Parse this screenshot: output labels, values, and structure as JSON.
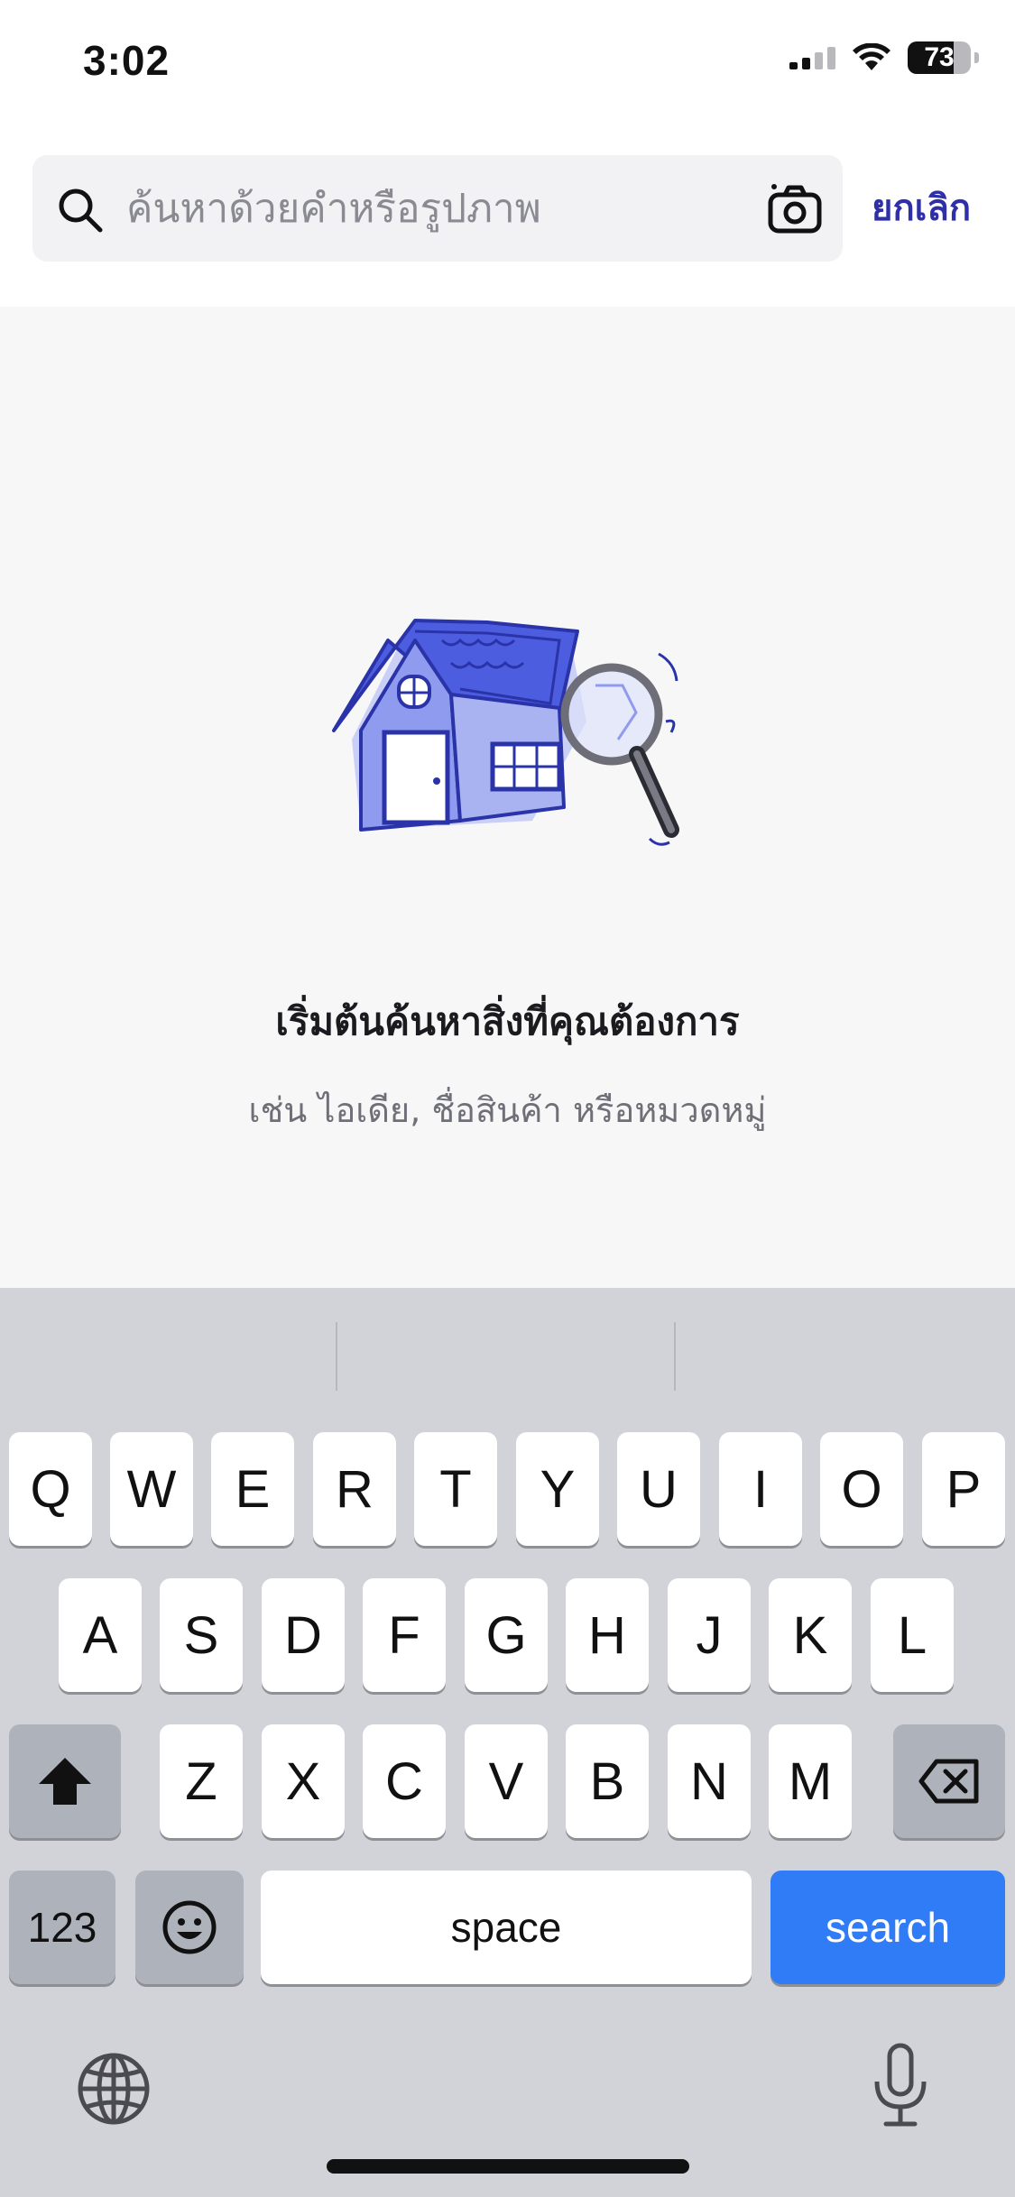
{
  "status_bar": {
    "time": "3:02",
    "battery": "73",
    "battery_level": 0.73
  },
  "search": {
    "placeholder": "ค้นหาด้วยคำหรือรูปภาพ",
    "value": "",
    "cancel_label": "ยกเลิก"
  },
  "empty_state": {
    "title": "เริ่มต้นค้นหาสิ่งที่คุณต้องการ",
    "subtitle": "เช่น ไอเดีย, ชื่อสินค้า หรือหมวดหมู่"
  },
  "keyboard": {
    "row1": [
      "Q",
      "W",
      "E",
      "R",
      "T",
      "Y",
      "U",
      "I",
      "O",
      "P"
    ],
    "row2": [
      "A",
      "S",
      "D",
      "F",
      "G",
      "H",
      "J",
      "K",
      "L"
    ],
    "row3": [
      "Z",
      "X",
      "C",
      "V",
      "B",
      "N",
      "M"
    ],
    "numbers_label": "123",
    "space_label": "space",
    "search_label": "search"
  },
  "colors": {
    "accent": "#2f2fa8",
    "search_key": "#2f7cf6",
    "illustration": "#4d5de0"
  },
  "icons": [
    "search-icon",
    "camera-icon",
    "globe-icon",
    "mic-icon",
    "shift-icon",
    "backspace-icon",
    "emoji-icon",
    "wifi-icon"
  ]
}
